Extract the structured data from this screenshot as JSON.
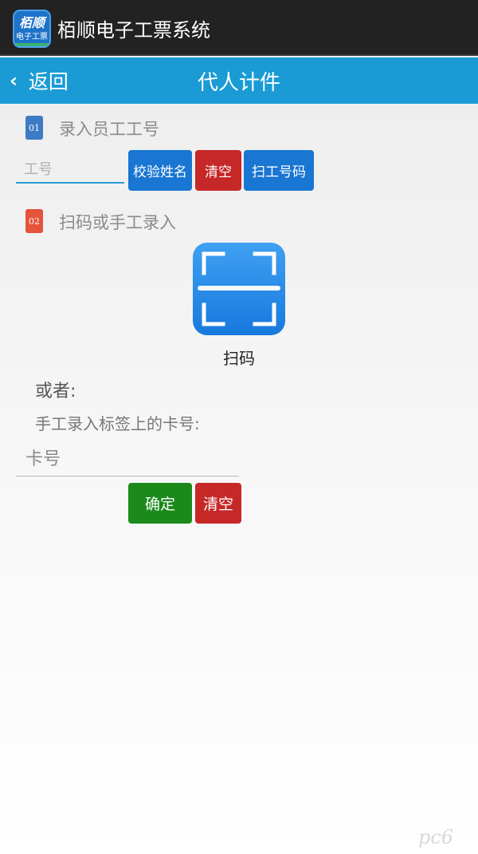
{
  "app": {
    "icon_line1": "栢顺",
    "icon_line2": "电子工票",
    "title": "栢顺电子工票系统"
  },
  "nav": {
    "back_label": "返回",
    "title": "代人计件"
  },
  "step1": {
    "badge": "01",
    "label": "录入员工工号",
    "employee_placeholder": "工号",
    "verify_button": "校验姓名",
    "clear_button": "清空",
    "scan_id_button": "扫工号码"
  },
  "step2": {
    "badge": "02",
    "label": "扫码或手工录入",
    "scan_label": "扫码",
    "or_text": "或者:",
    "manual_text": "手工录入标签上的卡号:",
    "card_placeholder": "卡号",
    "confirm_button": "确定",
    "clear_button": "清空"
  },
  "watermark": "pc6",
  "colors": {
    "titlebar": "#222222",
    "navbar": "#1a9bd6",
    "blue_button": "#1976d2",
    "red_button": "#c62828",
    "green_button": "#1b8a1b"
  }
}
